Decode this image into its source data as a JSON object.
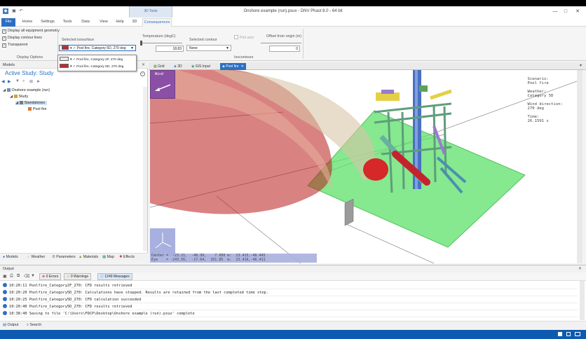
{
  "window": {
    "title": "Onshore example (run).psux - DNV Phast 8.0 - 64 bit",
    "minimize_glyph": "—",
    "maximize_glyph": "□",
    "close_glyph": "✕"
  },
  "ribbon": {
    "context_group": "3D Tools",
    "tabs": [
      "File",
      "Home",
      "Settings",
      "Tools",
      "Data",
      "View",
      "Help",
      "3D",
      "Consequences"
    ],
    "display_options": {
      "items": [
        {
          "label": "Display all equipment geometry",
          "checked": true
        },
        {
          "label": "Display contour lines",
          "checked": true
        },
        {
          "label": "Transparent",
          "checked": true
        }
      ],
      "group_label": "Display Options"
    },
    "isosurface": {
      "selected_label": "Selected isosurface",
      "selected_value": "Pool fire, Category 5D, 270 deg",
      "temperature_label": "Temperature (degC)",
      "temperature_value": "18.83",
      "selected_contour_label": "Selected contour",
      "selected_contour_value": "None",
      "plot_axis_label": "Plot axis",
      "offset_label": "Offset from origin (m)",
      "offset_value": "0",
      "group_label": "Isocontours"
    },
    "popup": [
      {
        "label": "Pool fire, Category 2F, 270 deg",
        "color": "#e9e9e9"
      },
      {
        "label": "Pool fire, Category 5D, 270 deg",
        "color": "#c0292f"
      }
    ]
  },
  "left_panel": {
    "header": "Models",
    "study_title": "Active Study: Study",
    "tree": [
      {
        "label": "Onshore example (run)",
        "level": 0,
        "color": "#6b8dbf"
      },
      {
        "label": "Study",
        "level": 1,
        "color": "#d8a03a"
      },
      {
        "label": "Standalones",
        "level": 2,
        "color": "#7a7a7a",
        "selected": true
      },
      {
        "label": "Pool fire",
        "level": 3,
        "color": "#d8793a"
      }
    ],
    "bottom_tabs": [
      "Models",
      "Weather",
      "Parameters",
      "Materials",
      "Map",
      "Effects"
    ]
  },
  "doc_tabs": [
    "Grid",
    "3D",
    "GIS Input",
    "Pool fire"
  ],
  "viewport": {
    "info": "Scenario:\nPool fire\n\nWeather:\nCategory 5D\n\nWind direction:\n270 deg\n\nTime:\n26.1591 s",
    "wind_label": "Wind",
    "coords_line1": "Center =  -23.21,  -46.99,    7.000 m:  23.415,-46.445",
    "coords_line2": "Eye    = -243.56,  -17.64,  101.85  m:  23.416,-46.411"
  },
  "output": {
    "header": "Output",
    "errors": "0 Errors",
    "warnings": "0 Warnings",
    "messages": "1249 Messages",
    "log": [
      "10:20:11 Poolfire_Category2F_270: CFD results retrieved",
      "10:20:20 Poolfire_Category5D_270: Calculations have stopped. Results are retained from the last completed time step.",
      "10:20:25 Poolfire_Category5D_270: CFD calculation succeeded",
      "10:20:40 Poolfire_Category5D_270: CFD results retrieved",
      "10:38:40 Saving to file 'C:\\Users\\FDCP\\Desktop\\Onshore example (run).psux' complete"
    ],
    "bottom_tabs": [
      "Output",
      "Search"
    ]
  }
}
